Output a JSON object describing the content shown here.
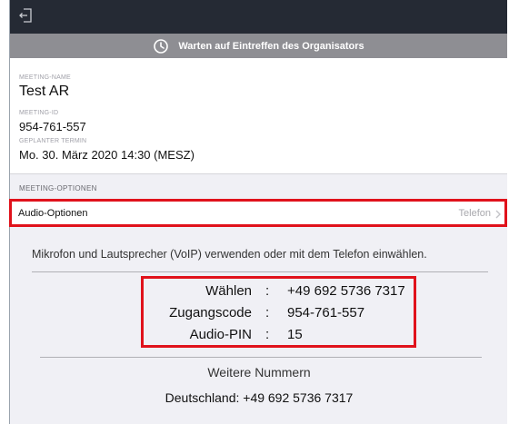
{
  "status": {
    "text": "Warten auf Eintreffen des Organisators"
  },
  "meeting": {
    "name_label": "MEETING-NAME",
    "name": "Test AR",
    "id_label": "MEETING-ID",
    "id": "954-761-557",
    "scheduled_label": "GEPLANTER TERMIN",
    "scheduled": "Mo. 30. März 2020 14:30 (MESZ)"
  },
  "options": {
    "section_label": "MEETING-OPTIONEN",
    "audio_label": "Audio-Optionen",
    "audio_value": "Telefon"
  },
  "audio": {
    "description": "Mikrofon und Lautsprecher (VoIP) verwenden oder mit dem Telefon einwählen.",
    "dial_key": "Wählen",
    "dial_value": "+49 692 5736 7317",
    "access_key": "Zugangscode",
    "access_value": "954-761-557",
    "pin_key": "Audio-PIN",
    "pin_value": "15",
    "separator": ":",
    "more_numbers": "Weitere Nummern",
    "country_number": "Deutschland: +49 692 5736 7317"
  },
  "colors": {
    "topbar": "#252a34",
    "status_bar": "#8e8e93",
    "highlight": "#e0121b"
  },
  "icons": {
    "exit": "exit-icon",
    "clock": "clock-icon",
    "chevron": "chevron-right-icon"
  }
}
